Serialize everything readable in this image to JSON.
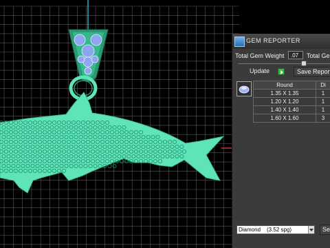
{
  "panel": {
    "title": "Gem Reporter",
    "total_gem_weight_label": "Total Gem Weight",
    "total_gem_weight_value": ".07",
    "total_gem_weight_label_2": "Total Gem",
    "update_label": "Update",
    "save_report_label": "Save Report",
    "table": {
      "headers": [
        "Round",
        "Di"
      ],
      "rows": [
        [
          "1.35 X 1.35",
          "1"
        ],
        [
          "1.20 X 1.20",
          "1"
        ],
        [
          "1.40 X 1.40",
          "1"
        ],
        [
          "1.60 X 1.60",
          "3"
        ]
      ]
    },
    "material": "Diamond",
    "spg": "(3.52 spg)",
    "select_label": "Se"
  },
  "colors": {
    "model": "#5fe3b8",
    "model_dark": "#2a9a76",
    "gem_blue": "#8fa6ee",
    "grid": "#5a5a5a",
    "axis_y": "#1fb6c8",
    "axis_x": "#c0392b"
  },
  "icons": {
    "title": "gem-reporter-icon",
    "gem_thumbnail": "round-gem-icon",
    "update": "play-arrow-icon",
    "dropdown": "chevron-down-icon"
  }
}
